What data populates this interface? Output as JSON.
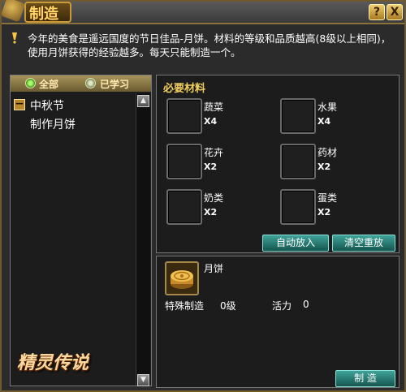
{
  "window": {
    "title": "制造",
    "help_label": "?",
    "close_label": "X"
  },
  "description": "今年的美食是遥远国度的节日佳品-月饼。材料的等级和品质越高(8级以上相同)，使用月饼获得的经验越多。每天只能制造一个。",
  "filters": {
    "all_label": "全部",
    "learned_label": "已学习",
    "selected": "全部"
  },
  "recipe_tree": {
    "category": "中秋节",
    "items": [
      {
        "label": "制作月饼"
      }
    ]
  },
  "logo_text": "精灵传说",
  "materials": {
    "title": "必要材料",
    "items": [
      {
        "name": "蔬菜",
        "qty": "X4"
      },
      {
        "name": "水果",
        "qty": "X4"
      },
      {
        "name": "花卉",
        "qty": "X2"
      },
      {
        "name": "药材",
        "qty": "X2"
      },
      {
        "name": "奶类",
        "qty": "X2"
      },
      {
        "name": "蛋类",
        "qty": "X2"
      }
    ],
    "auto_button": "自动放入",
    "clear_button": "清空重放"
  },
  "product": {
    "name": "月饼",
    "icon": "mooncake-icon",
    "special_label": "特殊制造",
    "special_level": "0级",
    "energy_label": "活力",
    "energy_value": "0",
    "make_button": "制 造"
  },
  "colors": {
    "accent_gold": "#f0d060",
    "button_teal": "#2a7f77",
    "panel_bg": "#1c1c1c"
  }
}
